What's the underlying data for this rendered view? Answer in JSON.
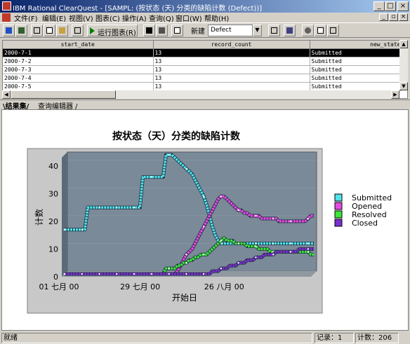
{
  "window": {
    "title": "IBM Rational ClearQuest - [SAMPL: (按状态 (天) 分类的缺陷计数 (Defect))]"
  },
  "menu": {
    "items": [
      "文件(F)",
      "编辑(E)",
      "视图(V)",
      "图表(C)",
      "操作(A)",
      "查询(Q)",
      "窗口(W)",
      "帮助(H)"
    ]
  },
  "toolbar": {
    "run_chart_label": "运行图表(R)",
    "new_label": "新建",
    "new_combo_value": "Defect"
  },
  "grid": {
    "columns": [
      "start_date",
      "record_count",
      "new_state"
    ],
    "rows": [
      [
        "2000-7-1",
        "13",
        "Submitted"
      ],
      [
        "2000-7-2",
        "13",
        "Submitted"
      ],
      [
        "2000-7-3",
        "13",
        "Submitted"
      ],
      [
        "2000-7-4",
        "13",
        "Submitted"
      ],
      [
        "2000-7-5",
        "13",
        "Submitted"
      ]
    ]
  },
  "tabs": [
    "结果集",
    "查询编辑器"
  ],
  "chart_data": {
    "type": "line",
    "title": "按状态（天）分类的缺陷计数",
    "xlabel": "开始日",
    "ylabel": "计数",
    "x_tick_labels": [
      "01 七月 00",
      "29 七月 00",
      "26 八月 00"
    ],
    "ylim": [
      0,
      43
    ],
    "y_ticks": [
      0,
      10,
      20,
      30,
      40
    ],
    "legend_position": "right",
    "series": [
      {
        "name": "Submitted",
        "color": "#4fe4ec",
        "values": [
          16,
          16,
          16,
          16,
          16,
          16,
          16,
          16,
          24,
          24,
          24,
          24,
          24,
          24,
          24,
          24,
          24,
          24,
          24,
          24,
          24,
          24,
          24,
          24,
          24,
          24,
          24,
          35,
          35,
          35,
          35,
          35,
          35,
          35,
          35,
          43,
          43,
          43,
          42,
          41,
          40,
          39,
          38,
          37,
          36,
          34,
          32,
          30,
          28,
          25,
          21,
          17,
          14,
          12,
          11,
          11,
          11,
          11,
          11,
          11,
          11,
          11,
          11,
          11,
          11,
          11,
          11,
          11,
          11,
          11,
          11,
          11,
          11,
          11,
          11,
          11,
          11,
          11,
          11,
          11,
          11,
          11,
          11,
          11,
          11,
          11,
          11
        ]
      },
      {
        "name": "Opened",
        "color": "#e64be6",
        "values": [
          0,
          0,
          0,
          0,
          0,
          0,
          0,
          0,
          0,
          0,
          0,
          0,
          0,
          0,
          0,
          0,
          0,
          0,
          0,
          0,
          0,
          0,
          0,
          0,
          0,
          0,
          0,
          0,
          0,
          0,
          0,
          0,
          0,
          0,
          0,
          0,
          0,
          0,
          0,
          1,
          3,
          5,
          7,
          8,
          9,
          11,
          13,
          15,
          17,
          19,
          21,
          23,
          25,
          27,
          28,
          28,
          27,
          26,
          25,
          24,
          23,
          23,
          22,
          22,
          21,
          21,
          21,
          21,
          20,
          20,
          20,
          20,
          20,
          20,
          19,
          19,
          19,
          19,
          19,
          19,
          19,
          19,
          19,
          19,
          20,
          21,
          21
        ]
      },
      {
        "name": "Resolved",
        "color": "#3ce63c",
        "values": [
          0,
          0,
          0,
          0,
          0,
          0,
          0,
          0,
          0,
          0,
          0,
          0,
          0,
          0,
          0,
          0,
          0,
          0,
          0,
          0,
          0,
          0,
          0,
          0,
          0,
          0,
          0,
          0,
          0,
          0,
          0,
          0,
          0,
          0,
          0,
          2,
          2,
          2,
          2,
          3,
          3,
          4,
          4,
          5,
          5,
          6,
          6,
          7,
          7,
          7,
          8,
          9,
          10,
          11,
          12,
          13,
          12,
          12,
          12,
          11,
          11,
          11,
          11,
          10,
          10,
          10,
          10,
          9,
          9,
          9,
          9,
          8,
          8,
          8,
          8,
          8,
          8,
          8,
          8,
          8,
          8,
          8,
          8,
          8,
          8,
          7,
          7
        ]
      },
      {
        "name": "Closed",
        "color": "#7b2fd0",
        "values": [
          0,
          0,
          0,
          0,
          0,
          0,
          0,
          0,
          0,
          0,
          0,
          0,
          0,
          0,
          0,
          0,
          0,
          0,
          0,
          0,
          0,
          0,
          0,
          0,
          0,
          0,
          0,
          0,
          0,
          0,
          0,
          0,
          0,
          0,
          0,
          0,
          0,
          0,
          0,
          0,
          0,
          0,
          0,
          0,
          0,
          0,
          0,
          0,
          0,
          0,
          0,
          1,
          1,
          1,
          2,
          2,
          2,
          3,
          3,
          3,
          4,
          4,
          4,
          5,
          5,
          5,
          6,
          6,
          6,
          7,
          7,
          7,
          7,
          8,
          8,
          8,
          8,
          8,
          8,
          8,
          8,
          9,
          9,
          9,
          9,
          9,
          9
        ]
      }
    ]
  },
  "status": {
    "ready": "就绪",
    "record": "记录：1",
    "count": "计数：206"
  }
}
